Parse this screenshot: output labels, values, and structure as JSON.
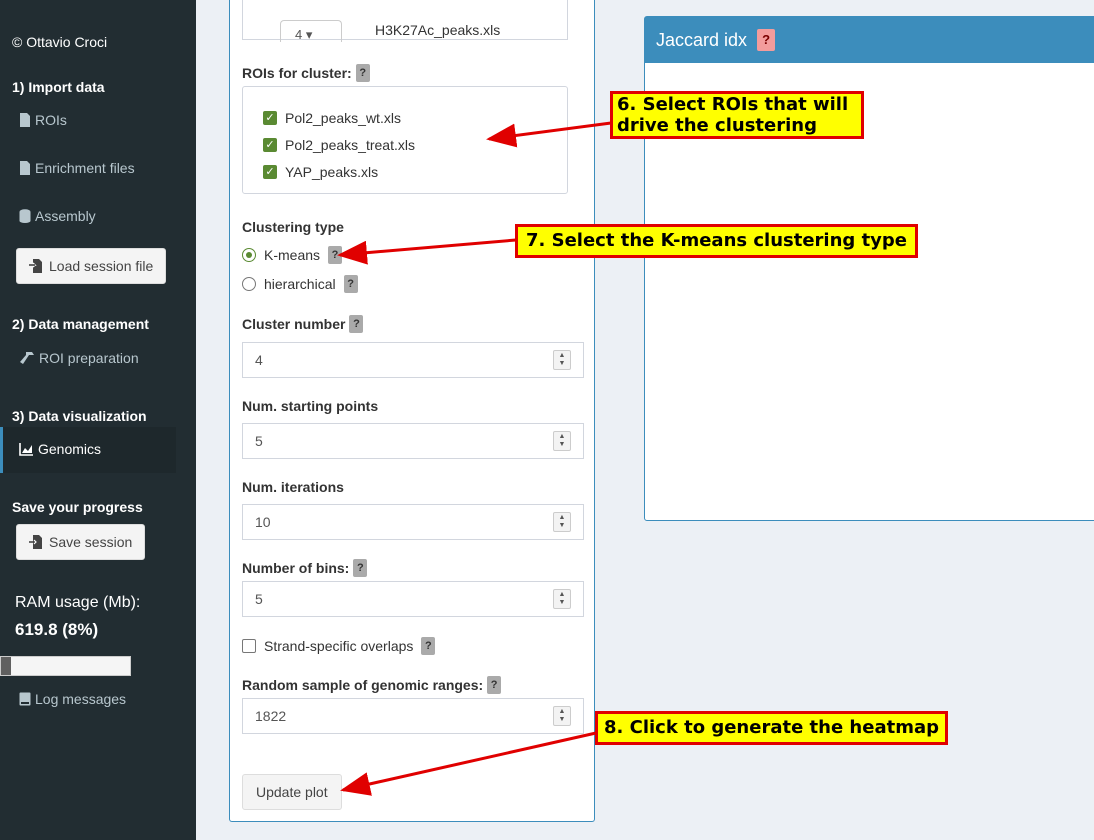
{
  "sidebar": {
    "copyright": "© Ottavio Croci",
    "section_import": "1) Import data",
    "item_rois": "ROIs",
    "item_enrichment": "Enrichment files",
    "item_assembly": "Assembly",
    "load_session": "Load session file",
    "section_management": "2) Data management",
    "item_roi_prep": "ROI preparation",
    "section_visualization": "3) Data visualization",
    "item_genomics": "Genomics",
    "section_save": "Save your progress",
    "save_session": "Save session",
    "ram_label": "RAM usage (Mb):",
    "ram_value": "619.8 (8%)",
    "ram_fraction": 0.08,
    "item_log": "Log messages"
  },
  "panel": {
    "top_select_value": "4",
    "top_filename": "H3K27Ac_peaks.xls",
    "rois_label": "ROIs for cluster:",
    "rois": [
      {
        "label": "Pol2_peaks_wt.xls",
        "checked": true
      },
      {
        "label": "Pol2_peaks_treat.xls",
        "checked": true
      },
      {
        "label": "YAP_peaks.xls",
        "checked": true
      }
    ],
    "clustering_type_label": "Clustering type",
    "clustering_options": [
      "K-means",
      "hierarchical"
    ],
    "clustering_selected": "K-means",
    "cluster_number_label": "Cluster number",
    "cluster_number": "4",
    "starting_points_label": "Num. starting points",
    "starting_points": "5",
    "iterations_label": "Num. iterations",
    "iterations": "10",
    "bins_label": "Number of bins:",
    "bins": "5",
    "strand_label": "Strand-specific overlaps",
    "random_label": "Random sample of genomic ranges:",
    "random_value": "1822",
    "update_button": "Update plot",
    "help": "?"
  },
  "jaccard": {
    "title": "Jaccard idx",
    "help": "?"
  },
  "annotations": {
    "note6_line1": "6. Select ROIs that will",
    "note6_line2": "drive the clustering",
    "note7": "7. Select the K-means clustering type",
    "note8": "8. Click to generate the heatmap"
  },
  "colors": {
    "sidebar_bg": "#222d32",
    "accent": "#3c8dbc",
    "annotation_fill": "#ffff00",
    "annotation_border": "#e00000"
  }
}
